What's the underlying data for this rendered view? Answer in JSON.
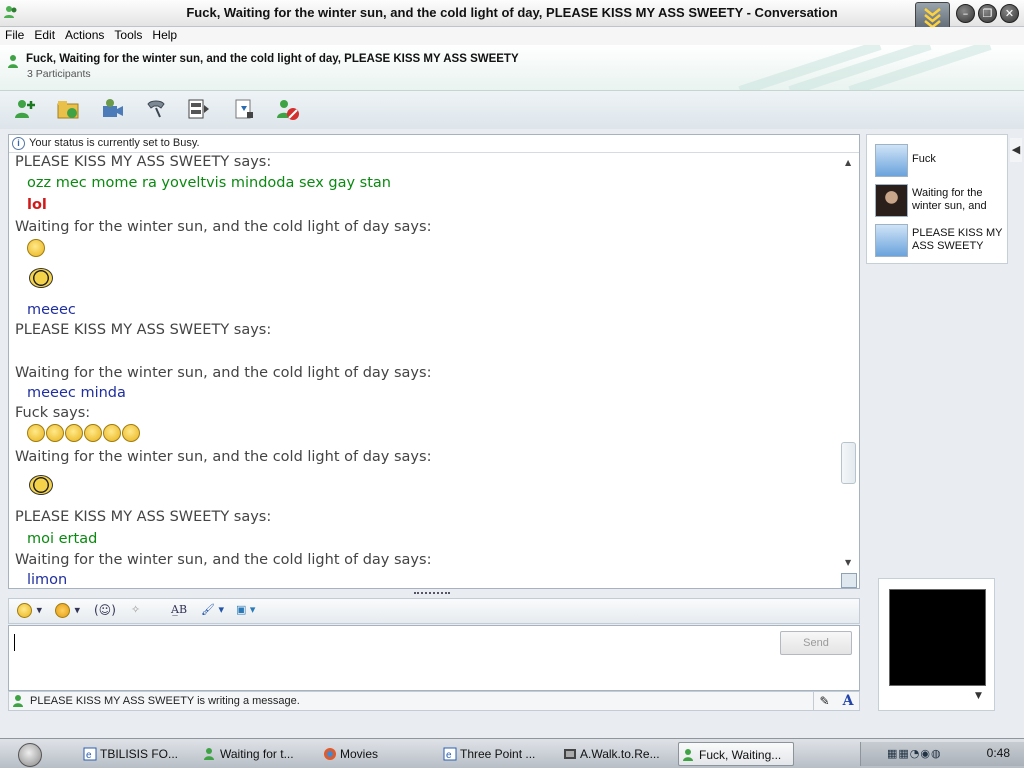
{
  "window": {
    "title": "Fuck, Waiting for the winter sun, and the cold light of day, PLEASE KISS MY ASS SWEETY - Conversation",
    "controls": {
      "minimize": "–",
      "maximize": "❐",
      "close": "✕"
    }
  },
  "menu": [
    "File",
    "Edit",
    "Actions",
    "Tools",
    "Help"
  ],
  "header": {
    "title": "Fuck, Waiting for the winter sun, and the cold light of day, PLEASE KISS MY ASS SWEETY",
    "subtitle": "3 Participants"
  },
  "toolbar": {
    "icons": [
      "invite-contact-icon",
      "send-files-icon",
      "video-call-icon",
      "voice-call-icon",
      "activities-icon",
      "games-icon",
      "block-icon"
    ]
  },
  "info": {
    "status_message": "Your status is currently set to Busy."
  },
  "conversation": {
    "speakers": {
      "please": "PLEASE KISS MY ASS SWEETY says:",
      "waiting": "Waiting for the winter sun, and the cold light of day says:",
      "fuck": "Fuck says:"
    },
    "messages": {
      "m1": "ozz mec mome ra yoveltvis mindoda sex gay stan",
      "m2": "lol",
      "m3": "meeec",
      "m4": "meeec minda",
      "m5": "moi ertad",
      "m6": "limon"
    },
    "colors": {
      "green": "#0a8a10",
      "red": "#d01a1a",
      "navy": "#1f2fa0"
    }
  },
  "input": {
    "value": "",
    "send_label": "Send"
  },
  "status_bar": {
    "typing_text": "PLEASE KISS MY ASS SWEETY is writing a message."
  },
  "participants": [
    {
      "name": "Fuck"
    },
    {
      "name": "Waiting for the winter sun, and"
    },
    {
      "name": "PLEASE KISS MY ASS SWEETY"
    }
  ],
  "taskbar": {
    "tasks": [
      {
        "label": "TBILISIS FO..."
      },
      {
        "label": "Waiting for t..."
      },
      {
        "label": "Movies"
      },
      {
        "label": "Three Point ..."
      },
      {
        "label": "A.Walk.to.Re..."
      },
      {
        "label": "Fuck, Waiting..."
      }
    ],
    "clock": "0:48"
  }
}
